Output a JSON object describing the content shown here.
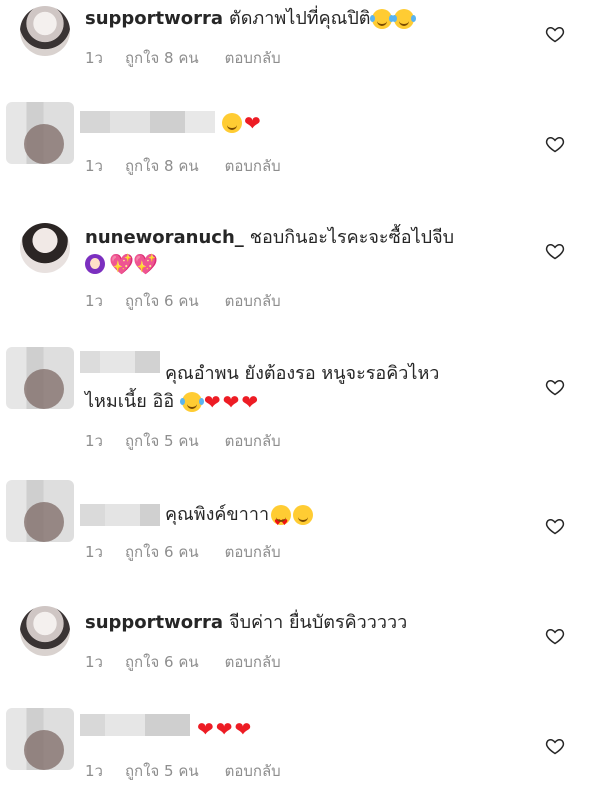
{
  "reply_label": "ตอบกลับ",
  "comments": [
    {
      "user": "supportworra",
      "text": "ตัดภาพไปที่คุณปิติ",
      "text2": "",
      "time": "1ว",
      "likes": "ถูกใจ 8 คน"
    },
    {
      "user": "",
      "text": "",
      "text2": "",
      "time": "1ว",
      "likes": "ถูกใจ 8 คน"
    },
    {
      "user": "nuneworanuch_",
      "text": "ชอบกินอะไรคะจะซื้อไปจีบ",
      "text2": "",
      "time": "1ว",
      "likes": "ถูกใจ 6 คน"
    },
    {
      "user": "",
      "text": "คุณอำพน ยังต้องรอ หนูจะรอคิวไหว",
      "text2": "ไหมเนี้ย อิอิ",
      "time": "1ว",
      "likes": "ถูกใจ 5 คน"
    },
    {
      "user": "",
      "text": "คุณพิงค์ขาาา",
      "text2": "",
      "time": "1ว",
      "likes": "ถูกใจ 6 คน"
    },
    {
      "user": "supportworra",
      "text": "จีบค่าา ยื่นบัตรคิววววว",
      "text2": "",
      "time": "1ว",
      "likes": "ถูกใจ 6 คน"
    },
    {
      "user": "",
      "text": "",
      "text2": "",
      "time": "1ว",
      "likes": "ถูกใจ 5 คน"
    }
  ],
  "icons": {
    "like": "heart-outline-icon"
  },
  "colors": {
    "heart": "#ed1c24",
    "meta": "#8e8e8e"
  }
}
